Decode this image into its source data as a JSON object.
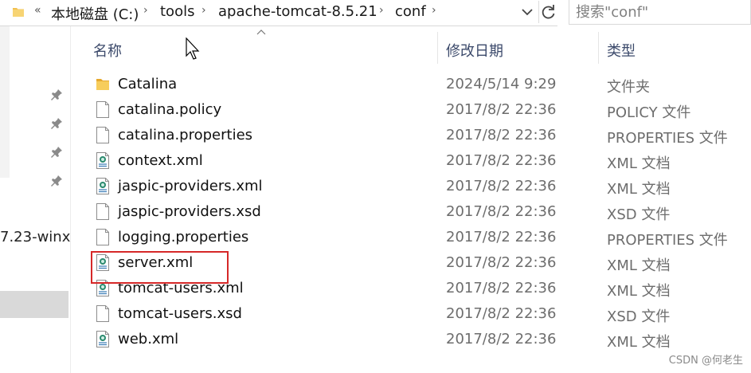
{
  "address": {
    "overflow_chevron": "«",
    "crumbs": [
      "本地磁盘 (C:)",
      "tools",
      "apache-tomcat-8.5.21",
      "conf"
    ],
    "separator": "›"
  },
  "search": {
    "placeholder": "搜索\"conf\""
  },
  "nav": {
    "partial_item": "7.23-winx"
  },
  "columns": {
    "name": "名称",
    "date": "修改日期",
    "type": "类型"
  },
  "files": [
    {
      "name": "Catalina",
      "date": "2024/5/14 9:29",
      "type": "文件夹",
      "icon": "folder-icon"
    },
    {
      "name": "catalina.policy",
      "date": "2017/8/2 22:36",
      "type": "POLICY 文件",
      "icon": "file-icon"
    },
    {
      "name": "catalina.properties",
      "date": "2017/8/2 22:36",
      "type": "PROPERTIES 文件",
      "icon": "file-icon"
    },
    {
      "name": "context.xml",
      "date": "2017/8/2 22:36",
      "type": "XML 文档",
      "icon": "xml-file-icon"
    },
    {
      "name": "jaspic-providers.xml",
      "date": "2017/8/2 22:36",
      "type": "XML 文档",
      "icon": "xml-file-icon"
    },
    {
      "name": "jaspic-providers.xsd",
      "date": "2017/8/2 22:36",
      "type": "XSD 文件",
      "icon": "file-icon"
    },
    {
      "name": "logging.properties",
      "date": "2017/8/2 22:36",
      "type": "PROPERTIES 文件",
      "icon": "file-icon"
    },
    {
      "name": "server.xml",
      "date": "2017/8/2 22:36",
      "type": "XML 文档",
      "icon": "xml-file-icon"
    },
    {
      "name": "tomcat-users.xml",
      "date": "2017/8/2 22:36",
      "type": "XML 文档",
      "icon": "xml-file-icon"
    },
    {
      "name": "tomcat-users.xsd",
      "date": "2017/8/2 22:36",
      "type": "XSD 文件",
      "icon": "file-icon"
    },
    {
      "name": "web.xml",
      "date": "2017/8/2 22:36",
      "type": "XML 文档",
      "icon": "xml-file-icon"
    }
  ],
  "highlight": {
    "file": "server.xml",
    "color": "#d62828"
  },
  "watermark": "CSDN @何老生",
  "colors": {
    "folder": "#f2c04e",
    "header_text": "#3c4a6b",
    "secondary_text": "#6d6d6d"
  }
}
